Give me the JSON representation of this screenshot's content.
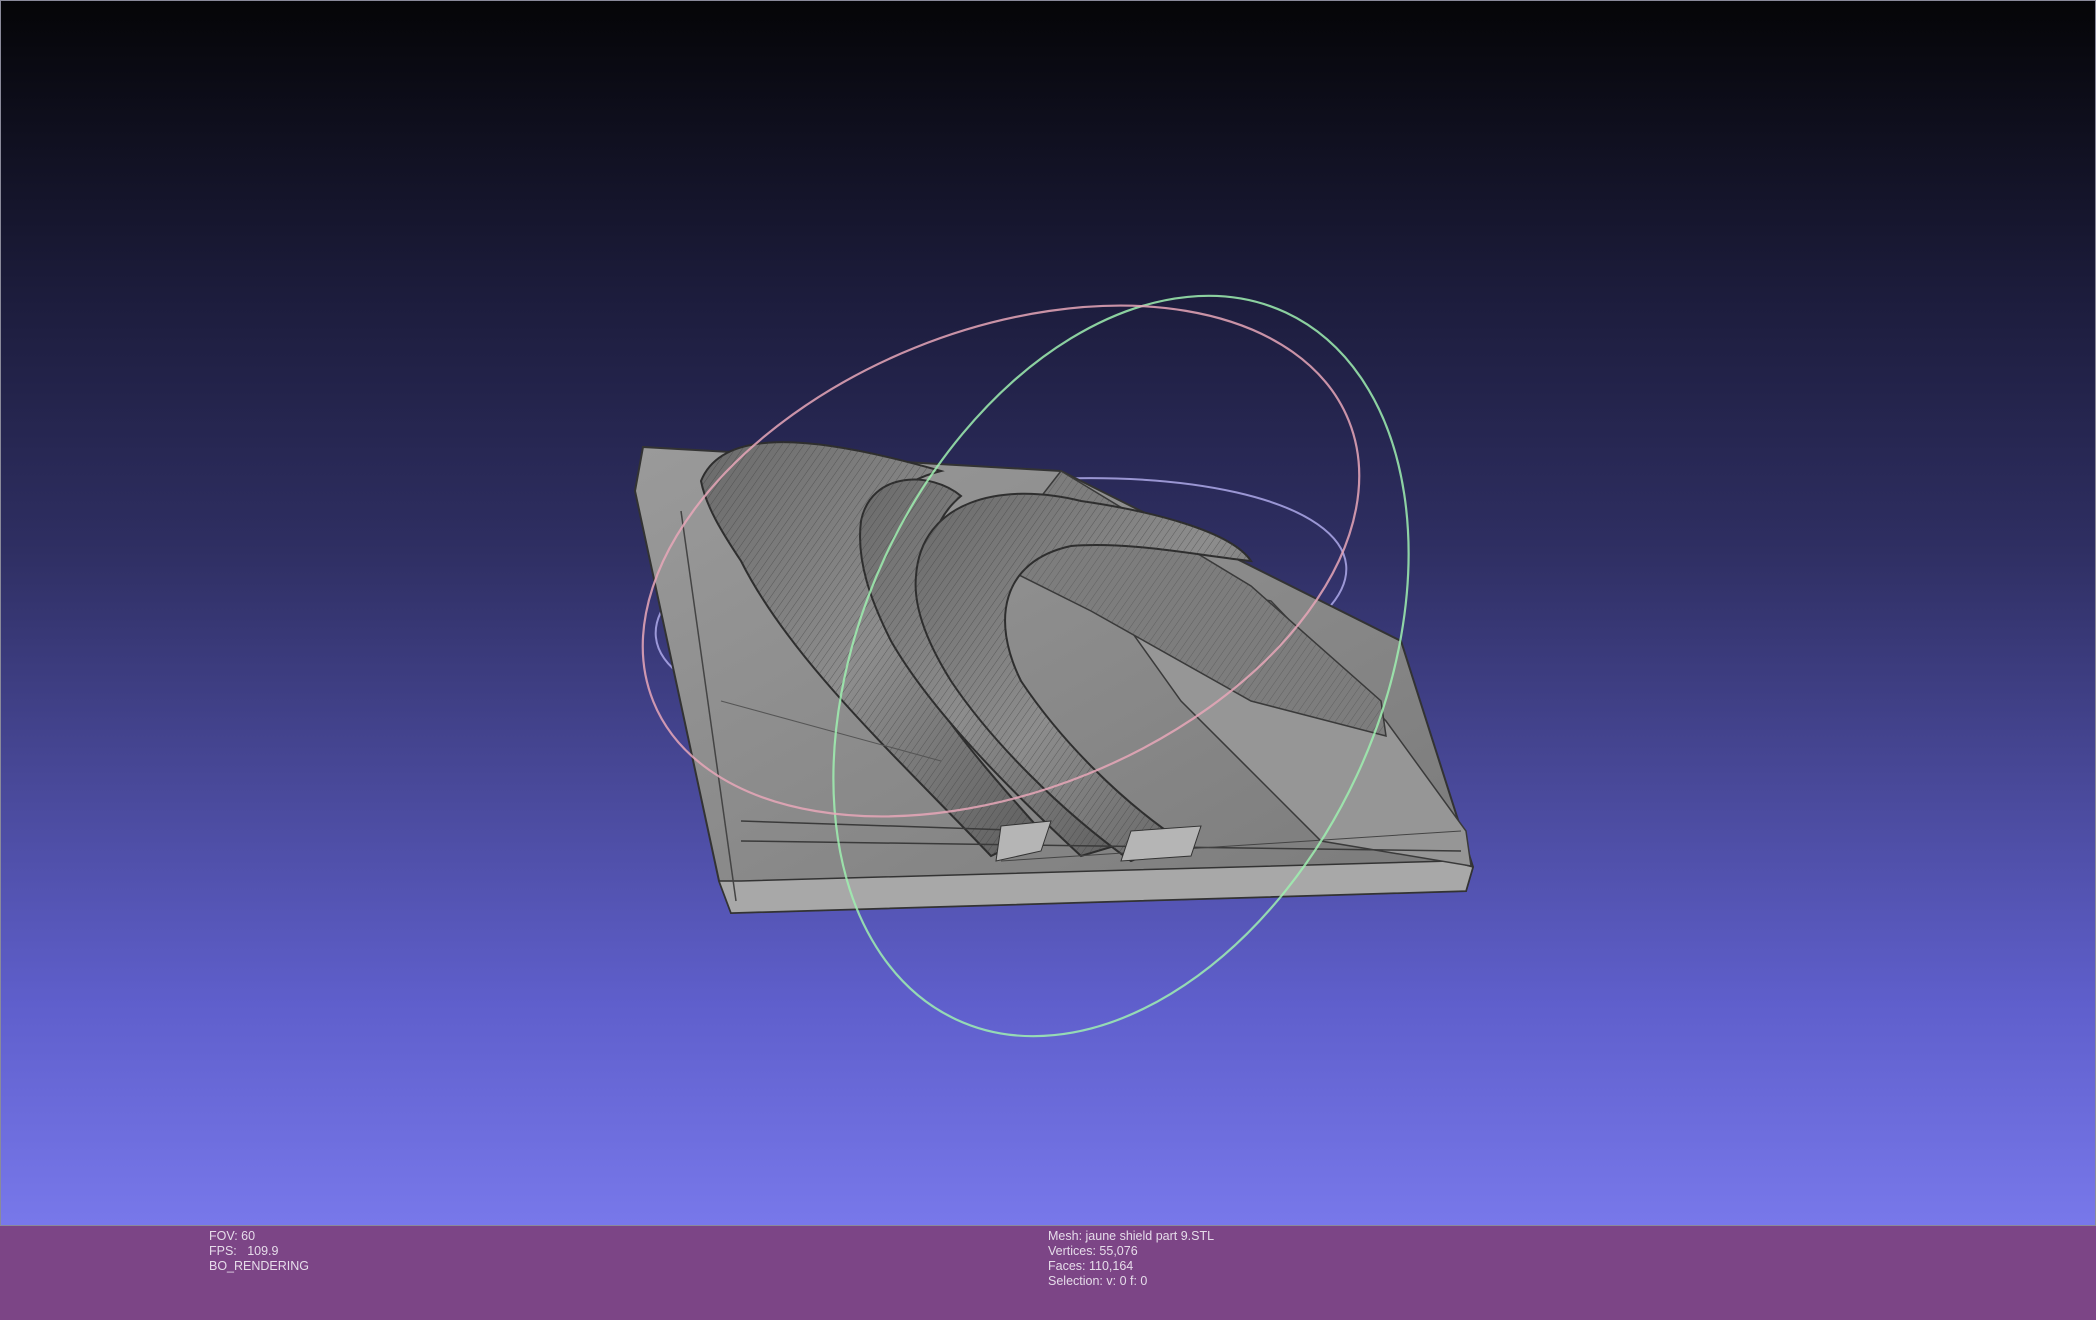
{
  "viewport": {
    "background_top": "#050507",
    "background_bottom": "#7878ea",
    "mesh_color": "#8c8c8c",
    "trackball_colors": {
      "x_ring": "#e7a7b9",
      "y_ring": "#9ff0b0",
      "z_ring": "#b7b2f2"
    }
  },
  "info_left": {
    "fov": "FOV: 60",
    "fps": "FPS:   109.9",
    "render_mode": "BO_RENDERING"
  },
  "info_right": {
    "mesh": "Mesh: jaune shield part 9.STL",
    "vertices": "Vertices: 55,076",
    "faces": "Faces: 110,164",
    "selection": "Selection: v: 0 f: 0"
  },
  "info_bar_color": "#7c4586"
}
